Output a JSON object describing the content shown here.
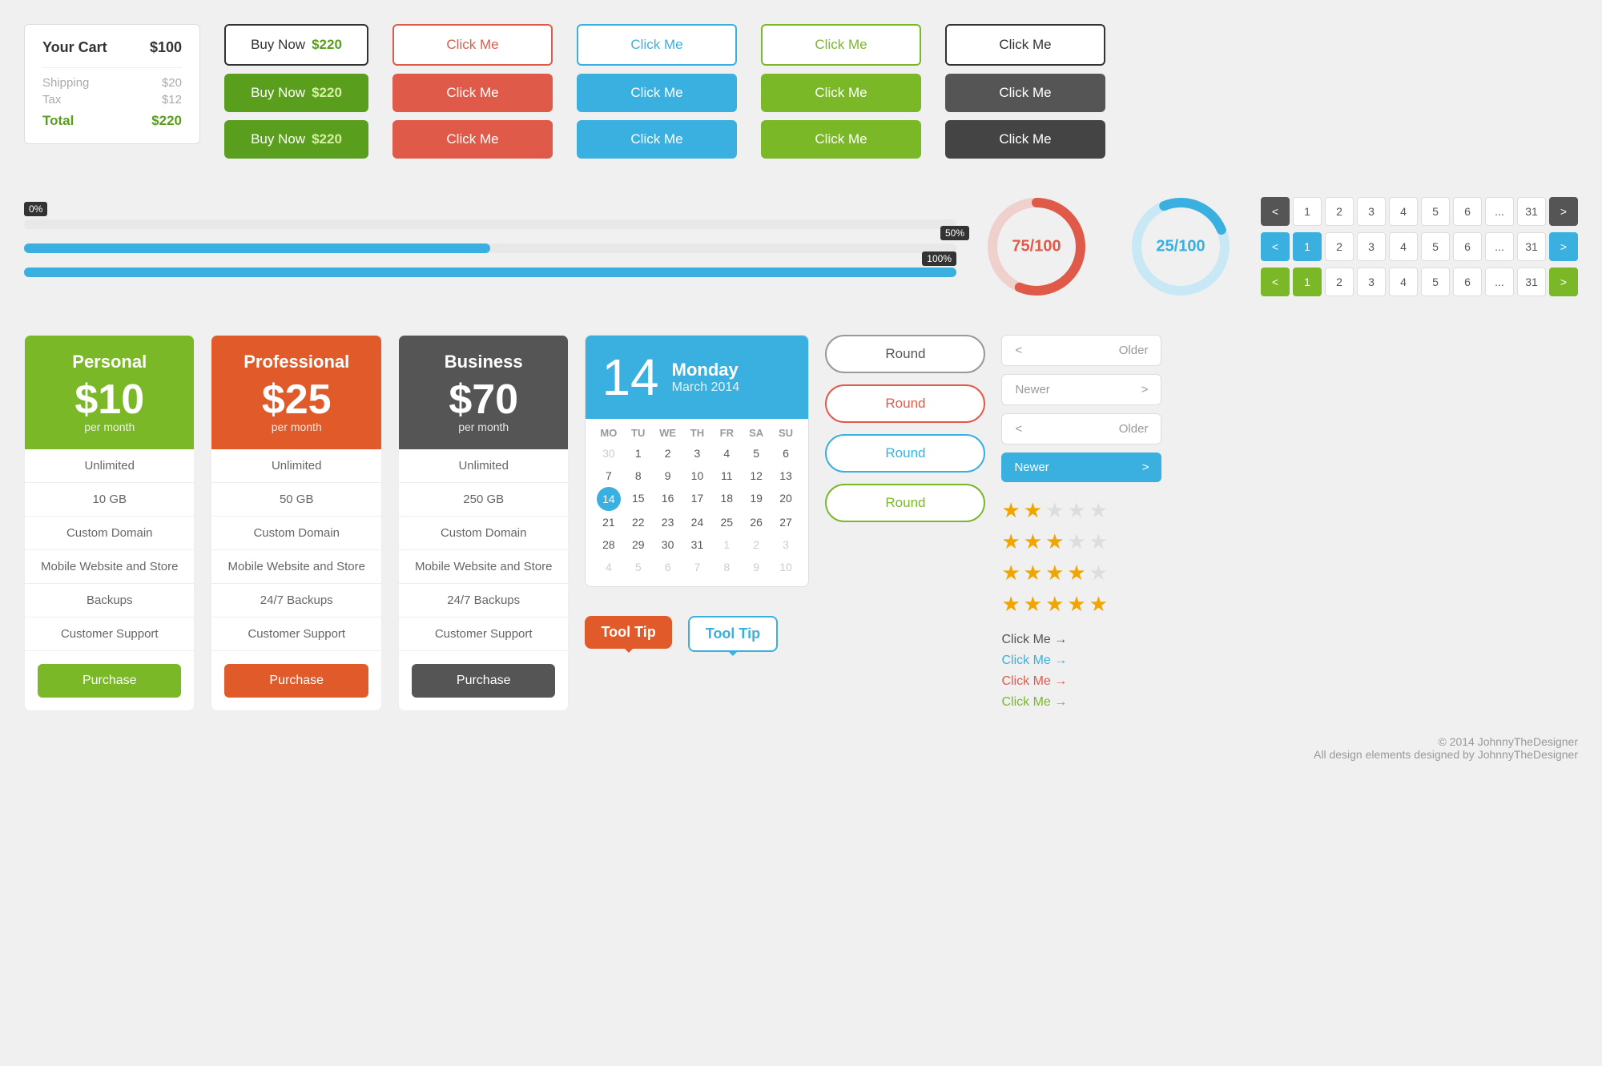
{
  "cart": {
    "title": "Your Cart",
    "total_top": "$100",
    "shipping_label": "Shipping",
    "shipping_value": "$20",
    "tax_label": "Tax",
    "tax_value": "$12",
    "total_label": "Total",
    "total_value": "$220"
  },
  "buy_now": {
    "outline_label": "Buy Now",
    "outline_price": "$220",
    "green1_label": "Buy Now",
    "green1_price": "$220",
    "green2_label": "Buy Now",
    "green2_price": "$220"
  },
  "buttons": {
    "click_me": "Click Me",
    "purchase": "Purchase",
    "round": "Round",
    "older": "Older",
    "newer": "Newer",
    "tool_tip_orange": "Tool Tip",
    "tool_tip_blue": "Tool Tip"
  },
  "progress": {
    "bar1_pct": 0,
    "bar1_label": "0%",
    "bar2_pct": 50,
    "bar2_label": "50%",
    "bar3_pct": 100,
    "bar3_label": "100%"
  },
  "donuts": {
    "red": {
      "value": 75,
      "max": 100,
      "label": "75/100"
    },
    "blue": {
      "value": 25,
      "max": 100,
      "label": "25/100"
    }
  },
  "pagination": {
    "pages": [
      "1",
      "2",
      "3",
      "4",
      "5",
      "6",
      "...",
      "31"
    ],
    "prev": "<",
    "next": ">"
  },
  "pricing": [
    {
      "plan": "Personal",
      "price": "$10",
      "period": "per month",
      "color": "green",
      "features": [
        "Unlimited",
        "10 GB",
        "Custom Domain",
        "Mobile Website and Store",
        "Backups",
        "Customer Support"
      ],
      "btn_label": "Purchase"
    },
    {
      "plan": "Professional",
      "price": "$25",
      "period": "per month",
      "color": "orange",
      "features": [
        "Unlimited",
        "50 GB",
        "Custom Domain",
        "Mobile Website and Store",
        "24/7 Backups",
        "Customer Support"
      ],
      "btn_label": "Purchase"
    },
    {
      "plan": "Business",
      "price": "$70",
      "period": "per month",
      "color": "dark",
      "features": [
        "Unlimited",
        "250 GB",
        "Custom Domain",
        "Mobile Website and Store",
        "24/7 Backups",
        "Customer Support"
      ],
      "btn_label": "Purchase"
    }
  ],
  "calendar": {
    "day_num": "14",
    "day_name": "Monday",
    "month_year": "March 2014",
    "weekdays": [
      "MO",
      "TU",
      "WE",
      "TH",
      "FR",
      "SA",
      "SU"
    ],
    "days": [
      {
        "d": "30",
        "other": true
      },
      {
        "d": "1"
      },
      {
        "d": "2"
      },
      {
        "d": "3"
      },
      {
        "d": "4"
      },
      {
        "d": "5"
      },
      {
        "d": "6"
      },
      {
        "d": "7"
      },
      {
        "d": "8"
      },
      {
        "d": "9"
      },
      {
        "d": "10"
      },
      {
        "d": "11"
      },
      {
        "d": "12"
      },
      {
        "d": "13"
      },
      {
        "d": "14",
        "today": true
      },
      {
        "d": "15"
      },
      {
        "d": "16"
      },
      {
        "d": "17"
      },
      {
        "d": "18"
      },
      {
        "d": "19"
      },
      {
        "d": "20"
      },
      {
        "d": "21"
      },
      {
        "d": "22"
      },
      {
        "d": "23"
      },
      {
        "d": "24"
      },
      {
        "d": "25"
      },
      {
        "d": "26"
      },
      {
        "d": "27"
      },
      {
        "d": "28"
      },
      {
        "d": "29"
      },
      {
        "d": "30"
      },
      {
        "d": "31"
      },
      {
        "d": "1",
        "other": true
      },
      {
        "d": "2",
        "other": true
      },
      {
        "d": "3",
        "other": true
      },
      {
        "d": "4",
        "other": true
      },
      {
        "d": "5",
        "other": true
      },
      {
        "d": "6",
        "other": true
      },
      {
        "d": "7",
        "other": true
      },
      {
        "d": "8",
        "other": true
      },
      {
        "d": "9",
        "other": true
      },
      {
        "d": "10",
        "other": true
      }
    ]
  },
  "stars": [
    {
      "filled": 2,
      "empty": 3
    },
    {
      "filled": 3,
      "empty": 2
    },
    {
      "filled": 4,
      "empty": 1
    },
    {
      "filled": 5,
      "empty": 0
    }
  ],
  "links": [
    {
      "text": "Click Me →",
      "color": "default"
    },
    {
      "text": "Click Me →",
      "color": "blue"
    },
    {
      "text": "Click Me →",
      "color": "red"
    },
    {
      "text": "Click Me →",
      "color": "green"
    }
  ],
  "footer": {
    "copy": "© 2014 JohnnyTheDesigner",
    "sub": "All design elements designed by JohnnyTheDesigner"
  }
}
